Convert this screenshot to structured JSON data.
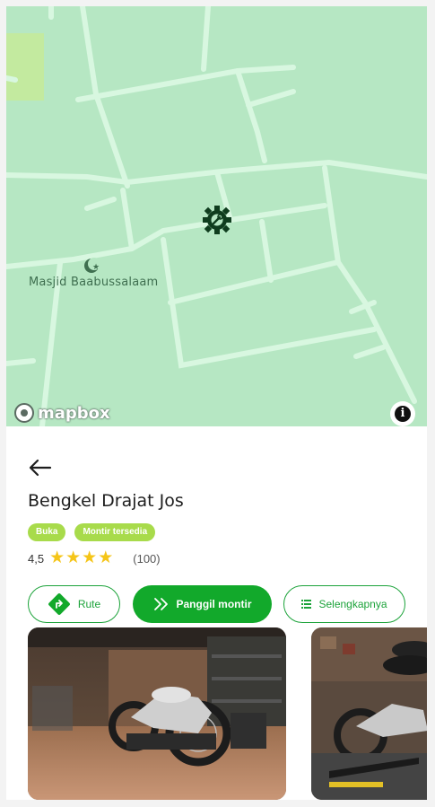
{
  "map": {
    "poi_label": "Masjid Baabussalaam",
    "attribution": "mapbox",
    "icons": {
      "poi": "mosque-icon",
      "marker": "workshop-gear-icon",
      "info": "info-icon"
    }
  },
  "detail": {
    "title": "Bengkel Drajat Jos",
    "badges": [
      "Buka",
      "Montir tersedia"
    ],
    "rating": {
      "score": "4,5",
      "stars": 4,
      "count": "(100)"
    },
    "actions": {
      "route": "Rute",
      "call": "Panggil montir",
      "more": "Selengkapnya"
    },
    "photos": [
      "workshop-photo-motorcycle",
      "workshop-photo-lift"
    ]
  },
  "colors": {
    "map_bg": "#b6e7c3",
    "road": "#d8f7e0",
    "accent": "#12a92b",
    "badge": "#a8db4b",
    "star": "#f5c518"
  }
}
